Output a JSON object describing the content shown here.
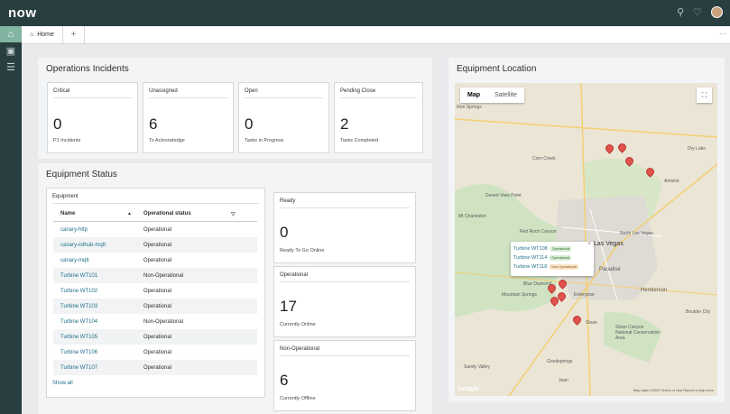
{
  "app": {
    "logo": "now"
  },
  "tabs": [
    {
      "label": "Home"
    }
  ],
  "operations": {
    "title": "Operations Incidents",
    "cards": [
      {
        "label": "Critical",
        "value": "0",
        "sub": "P1 Incidents"
      },
      {
        "label": "Unassigned",
        "value": "6",
        "sub": "To Acknowledge"
      },
      {
        "label": "Open",
        "value": "0",
        "sub": "Tasks in Progress"
      },
      {
        "label": "Pending Close",
        "value": "2",
        "sub": "Tasks Completed"
      }
    ]
  },
  "equipment": {
    "title": "Equipment Status",
    "table_title": "Equipment",
    "columns": [
      "Name",
      "Operational status"
    ],
    "rows": [
      {
        "name": "canary-http",
        "status": "Operational"
      },
      {
        "name": "canary-iothub-mqtt",
        "status": "Operational"
      },
      {
        "name": "canary-mqtt",
        "status": "Operational"
      },
      {
        "name": "Turbine WT101",
        "status": "Non-Operational"
      },
      {
        "name": "Turbine WT102",
        "status": "Operational"
      },
      {
        "name": "Turbine WT103",
        "status": "Operational"
      },
      {
        "name": "Turbine WT104",
        "status": "Non-Operational"
      },
      {
        "name": "Turbine WT105",
        "status": "Operational"
      },
      {
        "name": "Turbine WT106",
        "status": "Operational"
      },
      {
        "name": "Turbine WT107",
        "status": "Operational"
      }
    ],
    "show_all": "Show all",
    "stat_cards": [
      {
        "label": "Ready",
        "value": "0",
        "sub": "Ready To Go Online"
      },
      {
        "label": "Operational",
        "value": "17",
        "sub": "Currently Online"
      },
      {
        "label": "Non-Operational",
        "value": "6",
        "sub": "Currently Offline"
      }
    ]
  },
  "location": {
    "title": "Equipment Location",
    "map_type": "Map",
    "satellite": "Satellite",
    "popup": [
      {
        "name": "Turbine WT108",
        "status": "Operational"
      },
      {
        "name": "Turbine WT114",
        "status": "Operational"
      },
      {
        "name": "Turbine WT118",
        "status": "Non-Operational"
      }
    ],
    "places": [
      "Dry Lake",
      "Amsine",
      "Corn Creek",
      "Desert View Point",
      "Mt Charleston",
      "Red Rock Canyon",
      "North Las Vegas",
      "Las Vegas",
      "Paradise",
      "Henderson",
      "Blue Diamond",
      "Mountain Springs",
      "Enterprise",
      "Sloan",
      "Boulder City",
      "Sloan Canyon National Conservation Area",
      "Goodsprings",
      "Sandy Valley",
      "Jean",
      "Ilton Springs"
    ],
    "google": "Google",
    "attribution": "Map data ©2020  Terms of Use  Report a map error"
  }
}
